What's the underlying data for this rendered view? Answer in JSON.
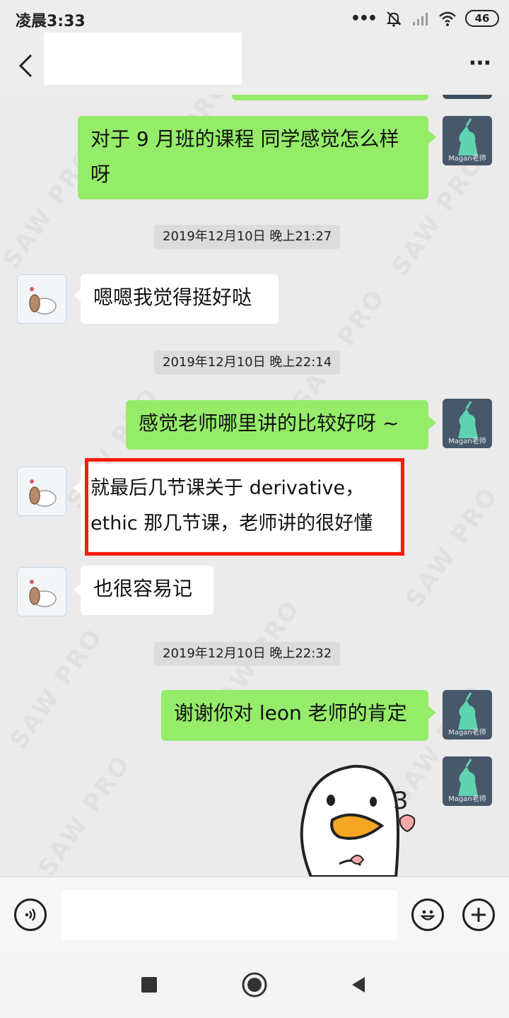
{
  "status_bar": {
    "time": "凌晨3:33",
    "more_dots": "•••",
    "battery": "46"
  },
  "header": {
    "back_icon": "chevron-left-icon",
    "more_icon": "more-horizontal-icon",
    "more_dots": "···"
  },
  "watermark": "SAW PRO",
  "messages": [
    {
      "type": "out",
      "text_line1": "对于 9 月班的课程 同学感觉怎么样",
      "text_line2": "呀"
    },
    {
      "type": "time",
      "text": "2019年12月10日 晚上21:27"
    },
    {
      "type": "in",
      "text": "嗯嗯我觉得挺好哒"
    },
    {
      "type": "time",
      "text": "2019年12月10日 晚上22:14"
    },
    {
      "type": "out",
      "text": "感觉老师哪里讲的比较好呀 ~"
    },
    {
      "type": "in",
      "text_line1": "就最后几节课关于 derivative，",
      "text_line2": "ethic 那几节课，老师讲的很好懂",
      "highlighted": true
    },
    {
      "type": "in",
      "text": "也很容易记"
    },
    {
      "type": "time",
      "text": "2019年12月10日 晚上22:32"
    },
    {
      "type": "out",
      "text": "谢谢你对 leon 老师的肯定"
    },
    {
      "type": "sticker",
      "sticker_text": "3",
      "description": "duck-sticker"
    }
  ],
  "teacher_avatar_label": "Magan老师",
  "input_bar": {
    "voice_icon": "voice-icon",
    "emoji_icon": "emoji-icon",
    "add_icon": "plus-icon",
    "text_value": ""
  },
  "system_nav": {
    "recent_icon": "square-icon",
    "home_icon": "circle-icon",
    "back_icon": "triangle-back-icon"
  },
  "colors": {
    "outgoing_bubble": "#95ec69",
    "incoming_bubble": "#ffffff",
    "highlight_border": "#ff1a0d",
    "chat_background": "#ebebeb"
  }
}
